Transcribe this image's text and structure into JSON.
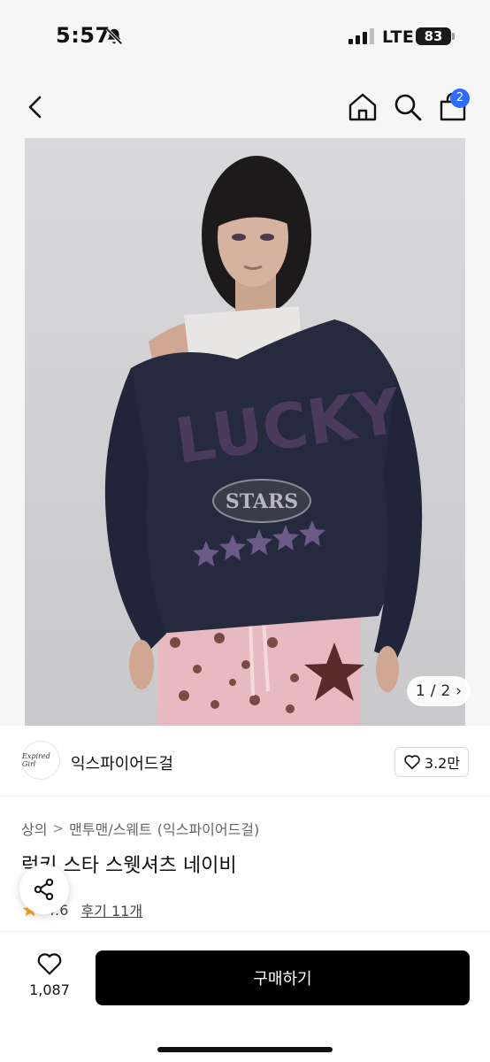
{
  "status_bar": {
    "time": "5:57",
    "network": "LTE",
    "battery": "83",
    "icons": [
      "bell-off-icon",
      "signal-icon"
    ]
  },
  "nav": {
    "icons": [
      "back-icon",
      "home-icon",
      "search-icon",
      "bag-icon"
    ],
    "cart_count": "2"
  },
  "gallery": {
    "current": "1",
    "separator": "/",
    "total": "2",
    "arrow": "›",
    "photo": {
      "garment_text_main": "LUCKY",
      "garment_text_patch": "STARS",
      "colors": {
        "sweatshirt": "#262a3f",
        "print": "#4a3a5e",
        "pants": "#e7b9c0",
        "spots": "#7a4a44",
        "background": "#d3d3d6"
      }
    }
  },
  "brand": {
    "logo_text": "Expired Girl",
    "name": "익스파이어드걸",
    "like_count": "3.2만"
  },
  "product": {
    "breadcrumb": [
      "상의",
      "맨투맨/스웨트",
      "(익스파이어드걸)"
    ],
    "breadcrumb_sep": ">",
    "title": "럭키 스타 스웻셔츠 네이비",
    "rating": "4.6",
    "review_link": "후기 11개"
  },
  "bottom_bar": {
    "wish_count": "1,087",
    "buy_label": "구매하기"
  },
  "colors": {
    "accent": "#2f6bff",
    "buy_button": "#000000",
    "star": "#f5a623"
  }
}
